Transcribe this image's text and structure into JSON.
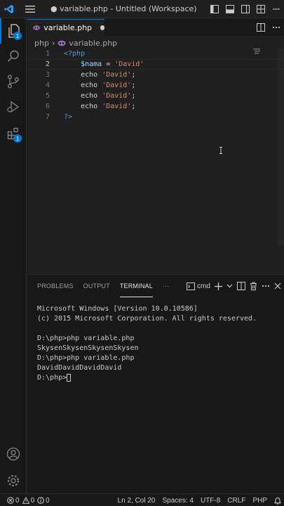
{
  "titlebar": {
    "title": "● variable.php - Untitled (Workspace) - Visual..."
  },
  "activity_bar": {
    "explorer_badge": "1",
    "extensions_badge": "1"
  },
  "editor": {
    "tab": {
      "label": "variable.php"
    },
    "breadcrumb": {
      "folder": "php",
      "separator": "›",
      "file": "variable.php"
    },
    "lines": [
      {
        "num": "1",
        "tokens": [
          {
            "t": "<?php",
            "c": "kw"
          }
        ]
      },
      {
        "num": "2",
        "tokens": [
          {
            "t": "    ",
            "c": "plain"
          },
          {
            "t": "$nama",
            "c": "var"
          },
          {
            "t": " = ",
            "c": "plain"
          },
          {
            "t": "'David'",
            "c": "str"
          }
        ]
      },
      {
        "num": "3",
        "tokens": [
          {
            "t": "    echo ",
            "c": "plain"
          },
          {
            "t": "'David'",
            "c": "str"
          },
          {
            "t": ";",
            "c": "plain"
          }
        ]
      },
      {
        "num": "4",
        "tokens": [
          {
            "t": "    echo ",
            "c": "plain"
          },
          {
            "t": "'David'",
            "c": "str"
          },
          {
            "t": ";",
            "c": "plain"
          }
        ]
      },
      {
        "num": "5",
        "tokens": [
          {
            "t": "    echo ",
            "c": "plain"
          },
          {
            "t": "'David'",
            "c": "str"
          },
          {
            "t": ";",
            "c": "plain"
          }
        ]
      },
      {
        "num": "6",
        "tokens": [
          {
            "t": "    echo ",
            "c": "plain"
          },
          {
            "t": "'David'",
            "c": "str"
          },
          {
            "t": ";",
            "c": "plain"
          }
        ]
      },
      {
        "num": "7",
        "tokens": [
          {
            "t": "?>",
            "c": "kw"
          }
        ]
      }
    ]
  },
  "panel": {
    "tabs": [
      "PROBLEMS",
      "OUTPUT",
      "TERMINAL"
    ],
    "more": "···",
    "shell": "cmd",
    "terminal_lines": [
      "Microsoft Windows [Version 10.0.10586]",
      "(c) 2015 Microsoft Corporation. All rights reserved.",
      "",
      "D:\\php>php variable.php",
      "SkysenSkysenSkysenSkysen",
      "D:\\php>php variable.php",
      "DavidDavidDavidDavid"
    ],
    "prompt": "D:\\php>"
  },
  "statusbar": {
    "errors": "0",
    "warnings": "0",
    "info": "0",
    "position": "Ln 2, Col 20",
    "spaces": "Spaces: 4",
    "encoding": "UTF-8",
    "eol": "CRLF",
    "language": "PHP"
  },
  "colors": {
    "accent": "#0078d4",
    "keyword": "#569cd6",
    "variable": "#9cdcfe",
    "string": "#ce9178"
  }
}
